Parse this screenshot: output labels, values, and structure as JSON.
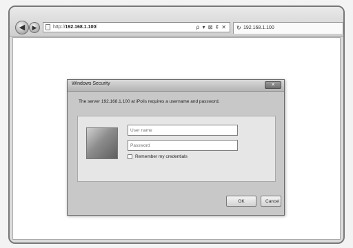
{
  "browser": {
    "back_glyph": "◀",
    "forward_glyph": "▶",
    "address": {
      "prefix": "http://",
      "host": "192.168.1.100",
      "suffix": "/",
      "actions": "ρ ▾ ⊠ ¢ ✕"
    },
    "tab": {
      "icon": "↻",
      "label": "192.168.1.100"
    }
  },
  "dialog": {
    "title": "Windows Security",
    "close_glyph": "✕",
    "message": "The server 192.168.1.100 at iPolis requires a username and password.",
    "username": {
      "placeholder": "User name",
      "value": ""
    },
    "password": {
      "placeholder": "Password",
      "value": ""
    },
    "remember_label": "Remember my credentials",
    "ok_label": "OK",
    "cancel_label": "Cancel"
  }
}
